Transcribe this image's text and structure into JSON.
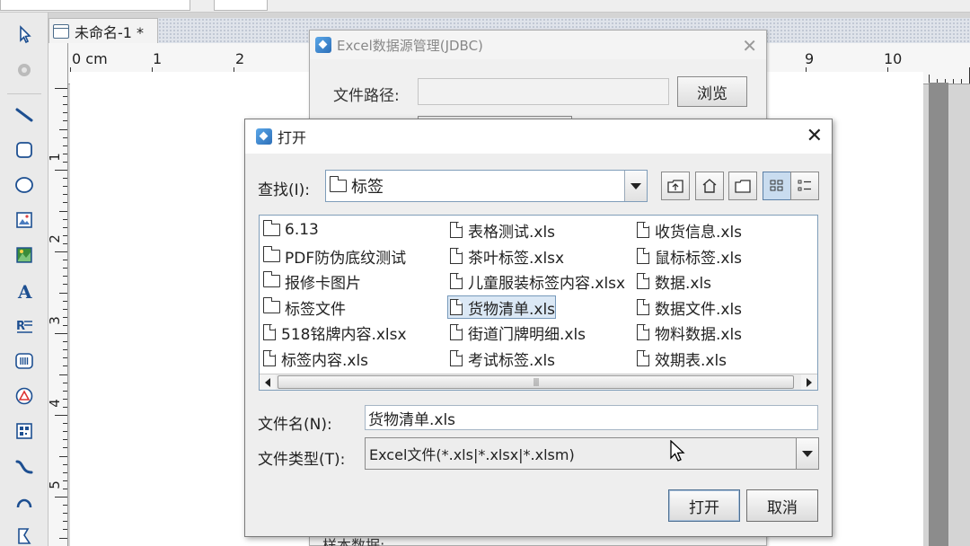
{
  "document": {
    "tab_title": "未命名-1 *",
    "ruler_h_labels": [
      {
        "text": "0 cm"
      },
      {
        "text": "1"
      },
      {
        "text": "2"
      },
      {
        "text": "9"
      },
      {
        "text": "10"
      }
    ],
    "ruler_v_labels": [
      "1",
      "2",
      "3",
      "4",
      "5"
    ]
  },
  "tools": [
    {
      "name": "select-arrow-icon"
    },
    {
      "name": "pan-disabled-icon"
    },
    {
      "name": "line-tool-icon"
    },
    {
      "name": "rounded-rect-tool-icon"
    },
    {
      "name": "ellipse-tool-icon"
    },
    {
      "name": "image-tool-icon"
    },
    {
      "name": "picture-tool-icon"
    },
    {
      "name": "text-tool-icon"
    },
    {
      "name": "rich-text-tool-icon"
    },
    {
      "name": "barcode-tool-icon"
    },
    {
      "name": "shape-tool-icon"
    },
    {
      "name": "qrcode-tool-icon"
    },
    {
      "name": "curve-tool-icon"
    },
    {
      "name": "arc-tool-icon"
    },
    {
      "name": "polygon-tool-icon"
    }
  ],
  "jdbc_dialog": {
    "title": "Excel数据源管理(JDBC)",
    "file_path_label": "文件路径:",
    "file_path_value": "",
    "browse_label": "浏览",
    "bottom_label": "样本数据:"
  },
  "open_dialog": {
    "title": "打开",
    "look_in_label": "查找(I):",
    "look_in_value": "标签",
    "file_name_label": "文件名(N):",
    "file_name_value": "货物清单.xls",
    "file_type_label": "文件类型(T):",
    "file_type_value": "Excel文件(*.xls|*.xlsx|*.xlsm)",
    "open_button": "打开",
    "cancel_button": "取消",
    "files": [
      {
        "name": "6.13",
        "type": "folder"
      },
      {
        "name": "PDF防伪底纹测试",
        "type": "folder"
      },
      {
        "name": "报修卡图片",
        "type": "folder"
      },
      {
        "name": "标签文件",
        "type": "folder"
      },
      {
        "name": "518铭牌内容.xlsx",
        "type": "file"
      },
      {
        "name": "标签内容.xls",
        "type": "file"
      },
      {
        "name": "表格测试.xls",
        "type": "file"
      },
      {
        "name": "茶叶标签.xlsx",
        "type": "file"
      },
      {
        "name": "儿童服装标签内容.xlsx",
        "type": "file"
      },
      {
        "name": "货物清单.xls",
        "type": "file",
        "selected": true
      },
      {
        "name": "街道门牌明细.xls",
        "type": "file"
      },
      {
        "name": "考试标签.xls",
        "type": "file"
      },
      {
        "name": "收货信息.xls",
        "type": "file"
      },
      {
        "name": "鼠标标签.xls",
        "type": "file"
      },
      {
        "name": "数据.xls",
        "type": "file"
      },
      {
        "name": "数据文件.xls",
        "type": "file"
      },
      {
        "name": "物料数据.xls",
        "type": "file"
      },
      {
        "name": "效期表.xls",
        "type": "file"
      }
    ]
  }
}
